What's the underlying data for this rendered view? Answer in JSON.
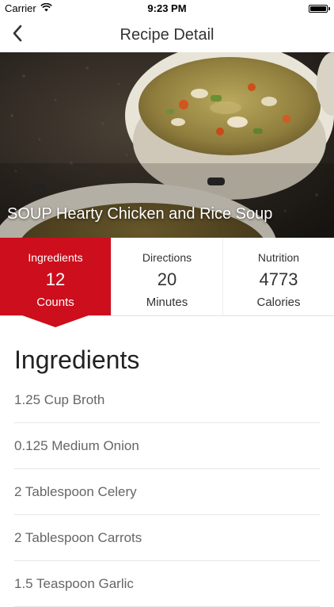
{
  "status_bar": {
    "carrier": "Carrier",
    "time": "9:23 PM",
    "battery_level": 1.0
  },
  "nav": {
    "title": "Recipe Detail",
    "back_icon": "chevron-left-icon"
  },
  "hero": {
    "title": "SOUP Hearty Chicken and Rice Soup"
  },
  "stats": [
    {
      "label": "Ingredients",
      "value": "12",
      "unit": "Counts",
      "active": true
    },
    {
      "label": "Directions",
      "value": "20",
      "unit": "Minutes",
      "active": false
    },
    {
      "label": "Nutrition",
      "value": "4773",
      "unit": "Calories",
      "active": false
    }
  ],
  "ingredients": {
    "title": "Ingredients",
    "items": [
      "1.25 Cup Broth",
      "0.125 Medium Onion",
      "2 Tablespoon Celery",
      "2 Tablespoon Carrots",
      "1.5 Teaspoon Garlic"
    ]
  },
  "colors": {
    "accent": "#cc0e1d"
  }
}
